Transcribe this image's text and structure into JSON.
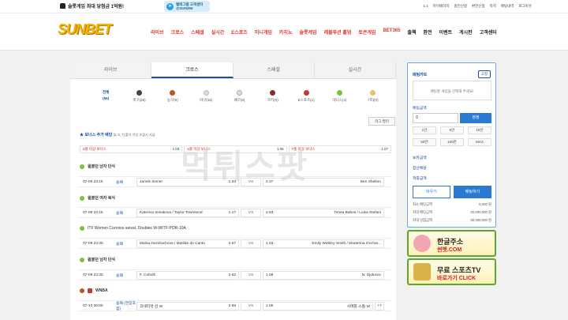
{
  "topbar": {
    "notice": "슬롯게임 최대 당첨금 1억원!",
    "telegram_line1": "텔레그램 고객센터",
    "telegram_line2": "@SUN365",
    "links": [
      "1:1",
      "마이페이지",
      "충전신청",
      "환전신청",
      "쪽지",
      "배팅내역",
      "로그아웃"
    ]
  },
  "header": {
    "logo": "SUNBET",
    "nav": [
      "라이브",
      "크로스",
      "스페셜",
      "실시간",
      "E스포츠",
      "미니게임",
      "카지노",
      "슬롯게임",
      "레볼루션 홀덤",
      "토큰게임",
      "BET365",
      "출첵",
      "환전",
      "이벤트",
      "게시판",
      "고객센터"
    ]
  },
  "tabs": [
    "라이브",
    "크로스",
    "스페셜",
    "실시간"
  ],
  "active_tab": 1,
  "sports": [
    {
      "name": "전체",
      "count": "(56)",
      "color": "#ffffff"
    },
    {
      "name": "축구",
      "count": "(26)",
      "color": "#444444"
    },
    {
      "name": "농구",
      "count": "(9)",
      "color": "#b8561b"
    },
    {
      "name": "야구",
      "count": "(15)",
      "color": "#dddddd"
    },
    {
      "name": "배구",
      "count": "(5)",
      "color": "#e0e0e0"
    },
    {
      "name": "하키",
      "count": "(0)",
      "color": "#8a2a2a"
    },
    {
      "name": "E스포츠",
      "count": "(1)",
      "color": "#c43a3a"
    },
    {
      "name": "테니스",
      "count": "(4)",
      "color": "#7bc043"
    },
    {
      "name": "기타",
      "count": "(0)",
      "color": "#e8c26a"
    }
  ],
  "league_button": "리그 필터",
  "bonus": {
    "title": "★ 보너스 추가 배당",
    "note": "[3, 5, 7] 폴더 이상 조합시 지급",
    "items": [
      {
        "label": "3폴 이상 보너스",
        "odds": "1.03"
      },
      {
        "label": "5폴 이상 보너스",
        "odds": "1.05"
      },
      {
        "label": "7폴 이상 보너스",
        "odds": "1.07"
      }
    ]
  },
  "games": [
    {
      "league": "윔블던 남자 단식",
      "time": "07-09 23:15",
      "type": "승패",
      "home": "Jannik Sinner",
      "home_odds": "1.33",
      "vs": "VS",
      "away": "Ben Shelton",
      "away_odds": "2.37"
    },
    {
      "league": "윔블던 여자 복식",
      "time": "07-09 23:15",
      "type": "승패",
      "home": "Katerina Siniakova / Taylor Townsend",
      "home_odds": "1.17",
      "vs": "VS",
      "away": "Timea Babos / Luisa Stefani",
      "away_odds": "2.53"
    },
    {
      "league": "ITF Women Corroios-seixal, Doubles W-WITF-POR-10A",
      "time": "07-09 23:30",
      "type": "승패",
      "home": "Mariia Nozdrachova / Matilde do Canto",
      "home_odds": "2.67",
      "vs": "VS",
      "away": "Emily Webley-Smith / Ekaterina Ovchar...",
      "away_odds": "1.03"
    },
    {
      "league": "윔블던 남자 단식",
      "time": "07-09 23:30",
      "type": "승패",
      "home": "F. Cobolli",
      "home_odds": "2.62",
      "vs": "VS",
      "away": "N. Djokovic",
      "away_odds": "1.08"
    },
    {
      "league": "WNBA",
      "time": "07-10 00:00",
      "type": "승패 (연장포함)",
      "home": "코네티컷 선 W",
      "home_odds": "2.68",
      "vs": "VS",
      "away": "시애틀 스톰 W",
      "away_odds": "1.05",
      "plus": "+7"
    }
  ],
  "betslip": {
    "title": "배팅카트",
    "reset": "고정",
    "empty": "배팅할 게임을 선택해 주세요!",
    "amount_label": "배팅금액",
    "amount_value": "0",
    "amount_button": "정정",
    "quick": [
      "1만",
      "5만",
      "10만",
      "50만",
      "100만",
      "MAX"
    ],
    "labels": [
      "보유금액",
      "합산배당",
      "적중금액"
    ],
    "cancel": "비우기",
    "submit": "배팅하기",
    "limits": [
      {
        "label": "최소 배팅금액",
        "value": "5,000 원"
      },
      {
        "label": "최대 배팅금액",
        "value": "20,000,000 원"
      },
      {
        "label": "최대 당첨금액",
        "value": "30,000,000 원"
      }
    ]
  },
  "banners": [
    {
      "title": "한글주소",
      "sub": "썬벳.COM"
    },
    {
      "title": "무료 스포츠TV",
      "sub": "바로가기 CLICK"
    }
  ],
  "watermark": "먹튀스팟"
}
